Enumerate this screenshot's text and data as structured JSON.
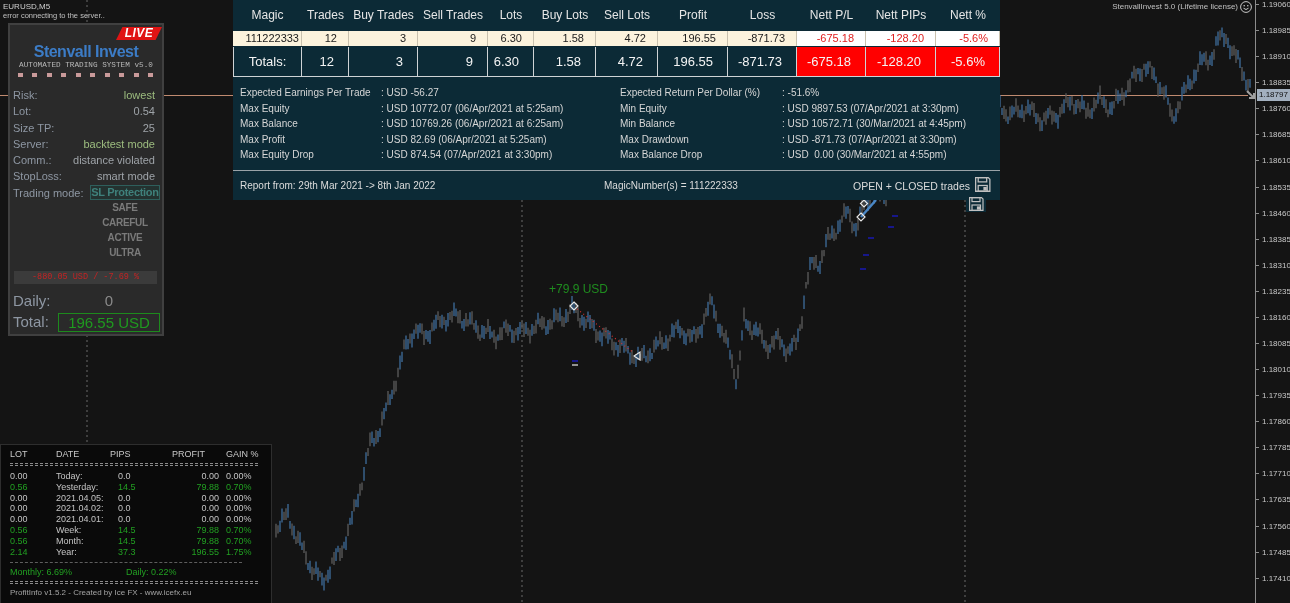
{
  "chart": {
    "symbol": "EURUSD,M5",
    "status": "error connecting to the server..",
    "license": "StenvallInvest 5.0 (Lifetime license)",
    "trade_label": "+79.9 USD",
    "price_axis": [
      "1.19060",
      "1.18985",
      "1.18910",
      "1.18835",
      "1.18760",
      "1.18685",
      "1.18610",
      "1.18535",
      "1.18460",
      "1.18385",
      "1.18310",
      "1.18235",
      "1.18160",
      "1.18085",
      "1.18010",
      "1.17935",
      "1.17860",
      "1.17785",
      "1.17710",
      "1.17635",
      "1.17560",
      "1.17485",
      "1.17410"
    ],
    "current_price": "1.18797"
  },
  "ea_panel": {
    "badge": "LIVE",
    "title": "Stenvall Invest",
    "subtitle": "AUTOMATED TRADING SYSTEM v5.0",
    "settings": [
      {
        "label": "Risk:",
        "value": "lowest",
        "highlighted": true
      },
      {
        "label": "Lot:",
        "value": "0.54",
        "highlighted": false
      },
      {
        "label": "Size TP:",
        "value": "25",
        "highlighted": false
      },
      {
        "label": "Server:",
        "value": "backtest mode",
        "highlighted": true
      },
      {
        "label": "Comm.:",
        "value": "distance violated",
        "highlighted": false
      },
      {
        "label": "StopLoss:",
        "value": "smart mode",
        "highlighted": false
      }
    ],
    "mode_label": "Trading mode:",
    "modes": [
      {
        "label": "SL Protection",
        "selected": true
      },
      {
        "label": "SAFE",
        "selected": false
      },
      {
        "label": "CAREFUL",
        "selected": false
      },
      {
        "label": "ACTIVE",
        "selected": false
      },
      {
        "label": "ULTRA",
        "selected": false
      }
    ],
    "drawdown": "-880.05 USD / -7.69 %",
    "daily_label": "Daily:",
    "daily_value": "0",
    "total_label": "Total:",
    "total_value": "196.55 USD"
  },
  "report": {
    "columns": [
      {
        "label": "Magic",
        "alert": false
      },
      {
        "label": "Trades",
        "alert": false
      },
      {
        "label": "Buy Trades",
        "alert": false
      },
      {
        "label": "Sell Trades",
        "alert": false
      },
      {
        "label": "Lots",
        "alert": false
      },
      {
        "label": "Buy Lots",
        "alert": false
      },
      {
        "label": "Sell Lots",
        "alert": false
      },
      {
        "label": "Profit",
        "alert": false
      },
      {
        "label": "Loss",
        "alert": false
      },
      {
        "label": "Nett P/L",
        "alert": true
      },
      {
        "label": "Nett PIPs",
        "alert": true
      },
      {
        "label": "Nett %",
        "alert": true
      }
    ],
    "rows": [
      [
        "111222333",
        "12",
        "3",
        "9",
        "6.30",
        "1.58",
        "4.72",
        "196.55",
        "-871.73",
        "-675.18",
        "-128.20",
        "-5.6%"
      ]
    ],
    "totals": [
      "Totals:",
      "12",
      "3",
      "9",
      "6.30",
      "1.58",
      "4.72",
      "196.55",
      "-871.73",
      "-675.18",
      "-128.20",
      "-5.6%"
    ],
    "stats_left": [
      {
        "label": "Expected Earnings Per Trade",
        "value": ": USD -56.27"
      },
      {
        "label": "Max Equity",
        "value": ": USD 10772.07 (06/Apr/2021 at 5:25am)"
      },
      {
        "label": "Max Balance",
        "value": ": USD 10769.26 (06/Apr/2021 at 6:25am)"
      },
      {
        "label": "Max Profit",
        "value": ": USD 82.69 (06/Apr/2021 at 5:25am)"
      },
      {
        "label": "Max Equity Drop",
        "value": ": USD 874.54 (07/Apr/2021 at 3:30pm)"
      }
    ],
    "stats_right": [
      {
        "label": "Expected Return Per Dollar (%)",
        "value": ": -51.6%"
      },
      {
        "label": "Min Equity",
        "value": ": USD 9897.53 (07/Apr/2021 at 3:30pm)"
      },
      {
        "label": "Min Balance",
        "value": ": USD 10572.71 (30/Mar/2021 at 4:45pm)"
      },
      {
        "label": "Max Drawdown",
        "value": ": USD -871.73 (07/Apr/2021 at 3:30pm)"
      },
      {
        "label": "Max Balance Drop",
        "value": ": USD  0.00 (30/Mar/2021 at 4:55pm)"
      }
    ],
    "period": "Report from: 29th Mar 2021 -> 8th Jan 2022",
    "magic_numbers": "MagicNumber(s) = 111222333",
    "scope": "OPEN + CLOSED trades"
  },
  "profit_info": {
    "columns": [
      "LOT",
      "DATE",
      "PIPS",
      "PROFIT",
      "GAIN %"
    ],
    "rows": [
      {
        "lot": "0.00",
        "date": "Today:",
        "pips": "0.0",
        "profit": "0.00",
        "gain": "0.00%",
        "positive": false
      },
      {
        "lot": "0.56",
        "date": "Yesterday:",
        "pips": "14.5",
        "profit": "79.88",
        "gain": "0.70%",
        "positive": true
      },
      {
        "lot": "0.00",
        "date": "2021.04.05:",
        "pips": "0.0",
        "profit": "0.00",
        "gain": "0.00%",
        "positive": false
      },
      {
        "lot": "0.00",
        "date": "2021.04.02:",
        "pips": "0.0",
        "profit": "0.00",
        "gain": "0.00%",
        "positive": false
      },
      {
        "lot": "0.00",
        "date": "2021.04.01:",
        "pips": "0.0",
        "profit": "0.00",
        "gain": "0.00%",
        "positive": false
      },
      {
        "lot": "0.56",
        "date": "Week:",
        "pips": "14.5",
        "profit": "79.88",
        "gain": "0.70%",
        "positive": true
      },
      {
        "lot": "0.56",
        "date": "Month:",
        "pips": "14.5",
        "profit": "79.88",
        "gain": "0.70%",
        "positive": true
      },
      {
        "lot": "2.14",
        "date": "Year:",
        "pips": "37.3",
        "profit": "196.55",
        "gain": "1.75%",
        "positive": true
      }
    ],
    "monthly": "Monthly: 6.69%",
    "daily": "Daily: 0.22%",
    "footer": "ProfitInfo v1.5.2 - Created by Ice FX - www.icefx.eu"
  }
}
